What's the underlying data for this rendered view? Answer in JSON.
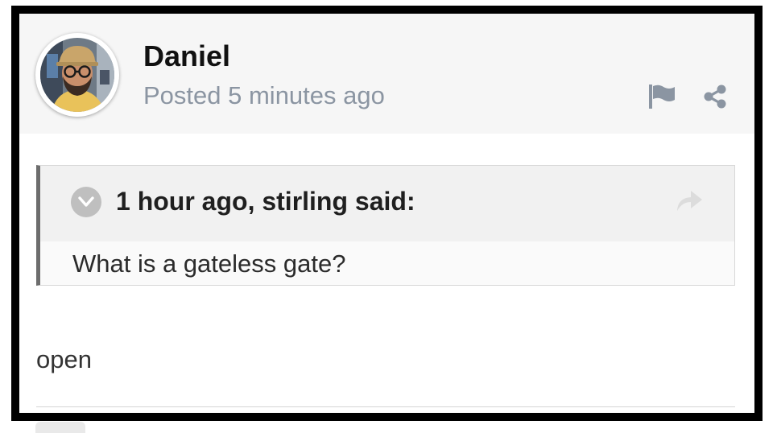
{
  "post": {
    "author": "Daniel",
    "posted": "Posted 5 minutes ago",
    "body": "open"
  },
  "quote": {
    "citation": "1 hour ago, stirling said:",
    "text": "What is a gateless gate?"
  },
  "icons": {
    "flag": "flag-icon",
    "share": "share-icon",
    "collapse": "chevron-down-icon",
    "goto": "reply-arrow-icon"
  },
  "colors": {
    "header_bg": "#f6f6f6",
    "meta_text": "#8b95a2",
    "icon_gray": "#8b95a2",
    "quote_border": "#6d6d6d",
    "frame": "#000000"
  }
}
